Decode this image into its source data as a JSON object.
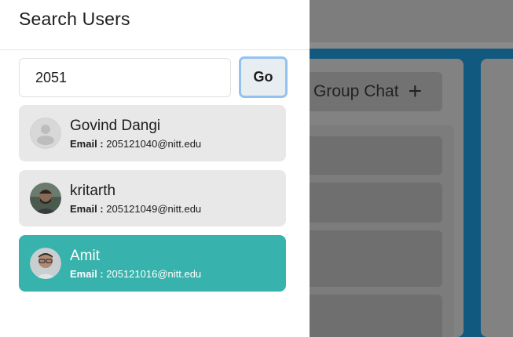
{
  "drawer": {
    "title": "Search Users",
    "search": {
      "value": "2051",
      "go_label": "Go"
    }
  },
  "results": [
    {
      "name": "Govind Dangi",
      "email_label": "Email :",
      "email": "205121040@nitt.edu",
      "avatar": "default-user-icon",
      "active": false
    },
    {
      "name": "kritarth",
      "email_label": "Email :",
      "email": "205121049@nitt.edu",
      "avatar": "photo-avatar",
      "active": false
    },
    {
      "name": "Amit",
      "email_label": "Email :",
      "email": "205121016@nitt.edu",
      "avatar": "photo-avatar",
      "active": true
    }
  ],
  "background": {
    "group_chat_label": "Group Chat",
    "plus_icon": "plus-icon"
  },
  "colors": {
    "active_item": "#38b2ac",
    "item": "#e8e8e8",
    "go_border": "#94c2ef",
    "background_accent": "#12597f"
  }
}
